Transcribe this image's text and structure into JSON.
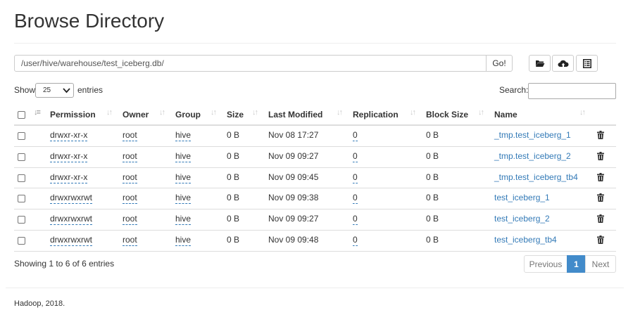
{
  "page": {
    "title": "Browse Directory"
  },
  "path_bar": {
    "value": "/user/hive/warehouse/test_iceberg.db/",
    "go_label": "Go!"
  },
  "toolbar": {
    "icons": [
      "folder-open-icon",
      "cloud-upload-icon",
      "list-alt-icon"
    ]
  },
  "table_controls": {
    "show_label": "Show",
    "page_size": "25",
    "entries_label": "entries",
    "search_label": "Search:",
    "search_value": ""
  },
  "table": {
    "columns": [
      "Permission",
      "Owner",
      "Group",
      "Size",
      "Last Modified",
      "Replication",
      "Block Size",
      "Name"
    ],
    "rows": [
      {
        "permission": "drwxr-xr-x",
        "owner": "root",
        "group": "hive",
        "size": "0 B",
        "last_modified": "Nov 08 17:27",
        "replication": "0",
        "block_size": "0 B",
        "name": "_tmp.test_iceberg_1"
      },
      {
        "permission": "drwxr-xr-x",
        "owner": "root",
        "group": "hive",
        "size": "0 B",
        "last_modified": "Nov 09 09:27",
        "replication": "0",
        "block_size": "0 B",
        "name": "_tmp.test_iceberg_2"
      },
      {
        "permission": "drwxr-xr-x",
        "owner": "root",
        "group": "hive",
        "size": "0 B",
        "last_modified": "Nov 09 09:45",
        "replication": "0",
        "block_size": "0 B",
        "name": "_tmp.test_iceberg_tb4"
      },
      {
        "permission": "drwxrwxrwt",
        "owner": "root",
        "group": "hive",
        "size": "0 B",
        "last_modified": "Nov 09 09:38",
        "replication": "0",
        "block_size": "0 B",
        "name": "test_iceberg_1"
      },
      {
        "permission": "drwxrwxrwt",
        "owner": "root",
        "group": "hive",
        "size": "0 B",
        "last_modified": "Nov 09 09:27",
        "replication": "0",
        "block_size": "0 B",
        "name": "test_iceberg_2"
      },
      {
        "permission": "drwxrwxrwt",
        "owner": "root",
        "group": "hive",
        "size": "0 B",
        "last_modified": "Nov 09 09:48",
        "replication": "0",
        "block_size": "0 B",
        "name": "test_iceberg_tb4"
      }
    ]
  },
  "pagination": {
    "info": "Showing 1 to 6 of 6 entries",
    "previous": "Previous",
    "current": "1",
    "next": "Next"
  },
  "footer": {
    "text": "Hadoop, 2018."
  },
  "colors": {
    "link": "#337ab7",
    "active_page": "#428bca"
  }
}
